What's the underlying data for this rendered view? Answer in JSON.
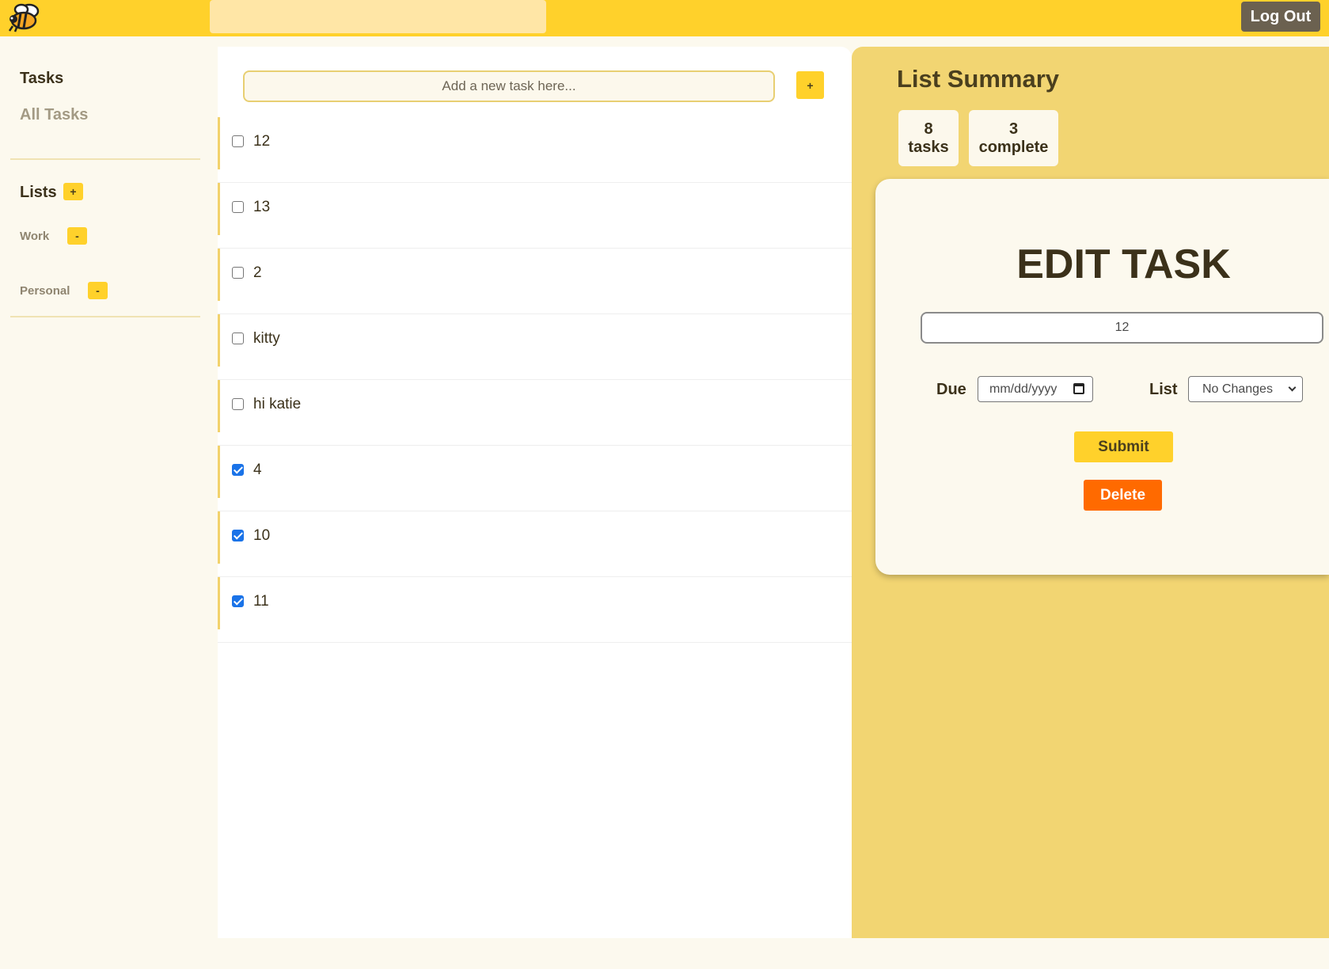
{
  "header": {
    "logo_icon": "bee-icon",
    "search": {
      "value": "",
      "placeholder": ""
    },
    "logout_label": "Log Out"
  },
  "sidebar": {
    "tasks_heading": "Tasks",
    "all_tasks_label": "All Tasks",
    "lists_heading": "Lists",
    "add_list_label": "+",
    "lists": [
      {
        "label": "Work",
        "remove_label": "-"
      },
      {
        "label": "Personal",
        "remove_label": "-"
      }
    ]
  },
  "main": {
    "new_task": {
      "value": "",
      "placeholder": "Add a new task here..."
    },
    "add_task_label": "+",
    "tasks": [
      {
        "label": "12",
        "checked": false
      },
      {
        "label": "13",
        "checked": false
      },
      {
        "label": "2",
        "checked": false
      },
      {
        "label": "kitty",
        "checked": false
      },
      {
        "label": "hi katie",
        "checked": false
      },
      {
        "label": "4",
        "checked": true
      },
      {
        "label": "10",
        "checked": true
      },
      {
        "label": "11",
        "checked": true
      }
    ]
  },
  "summary": {
    "title": "List Summary",
    "task_count": "8",
    "task_count_label": "tasks",
    "complete_count": "3",
    "complete_count_label": "complete"
  },
  "edit": {
    "title": "EDIT TASK",
    "name_value": "12",
    "due_label": "Due",
    "due_placeholder": "mm/dd/yyyy",
    "list_label": "List",
    "list_selected": "No Changes",
    "submit_label": "Submit",
    "delete_label": "Delete"
  },
  "colors": {
    "accent": "#ffd12b",
    "panel": "#f2d572",
    "delete": "#ff6a00",
    "checkbox_checked": "#1a73e8"
  }
}
